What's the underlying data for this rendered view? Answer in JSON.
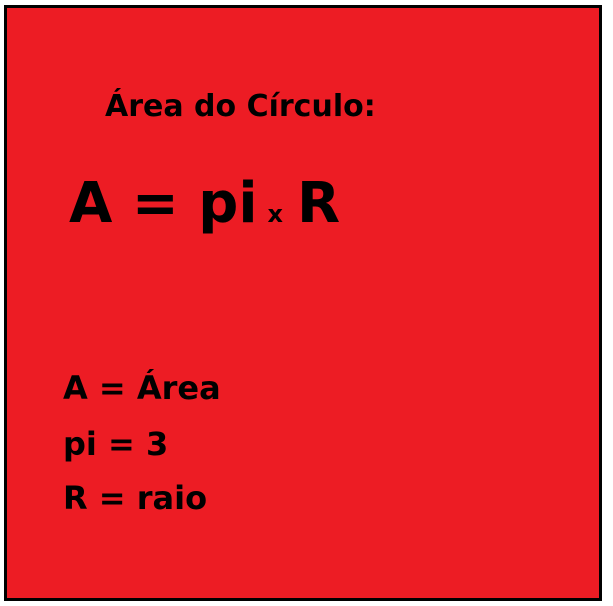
{
  "title": "Área do Círculo:",
  "formula": {
    "lhs": "A = pi",
    "operator": "x",
    "rhs": "R"
  },
  "legend": [
    "A = Área",
    "pi = 3",
    "R = raio"
  ],
  "colors": {
    "background": "#ed1c24",
    "border": "#000000",
    "text": "#000000"
  }
}
